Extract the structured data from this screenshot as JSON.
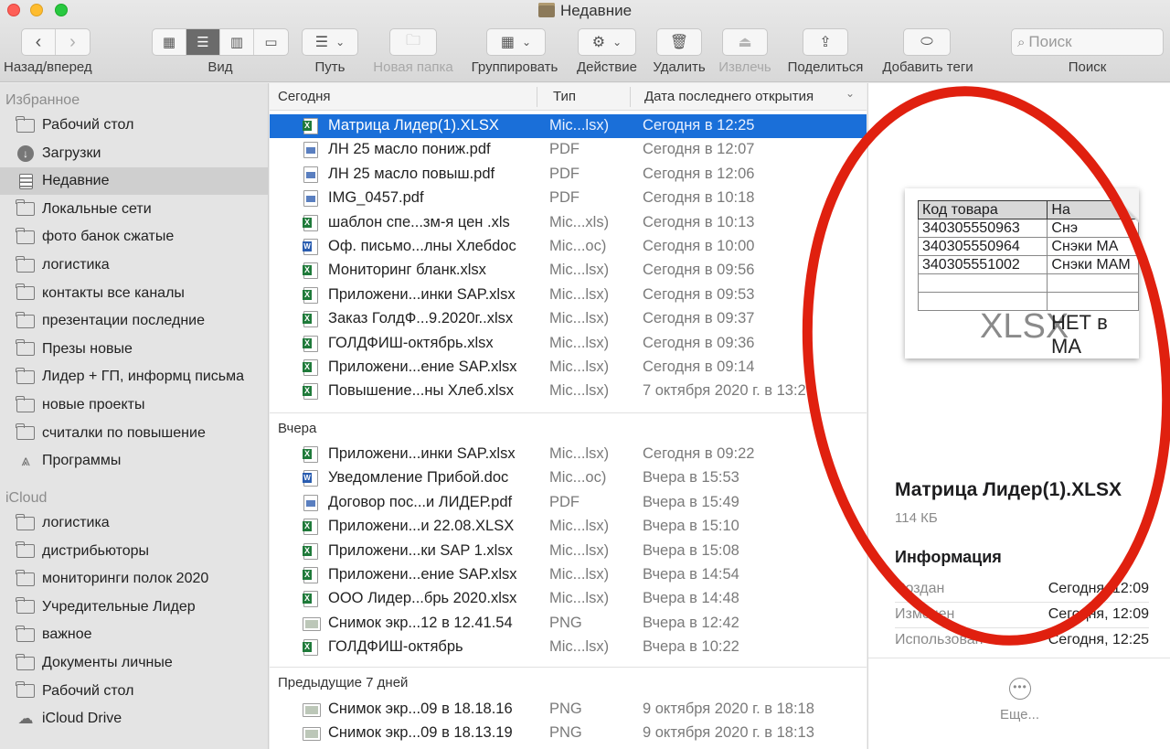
{
  "window": {
    "title": "Недавние"
  },
  "toolbar": {
    "nav_label": "Назад/вперед",
    "view_label": "Вид",
    "path_label": "Путь",
    "new_folder_label": "Новая папка",
    "group_label": "Группировать",
    "action_label": "Действие",
    "delete_label": "Удалить",
    "eject_label": "Извлечь",
    "share_label": "Поделиться",
    "tags_label": "Добавить теги",
    "search_label": "Поиск",
    "search_placeholder": "Поиск"
  },
  "sidebar": {
    "favorites_header": "Избранное",
    "favorites": [
      {
        "label": "Рабочий стол",
        "icon": "folder-icon"
      },
      {
        "label": "Загрузки",
        "icon": "downloads-icon"
      },
      {
        "label": "Недавние",
        "icon": "recents-icon",
        "active": true
      },
      {
        "label": "Локальные сети",
        "icon": "folder-icon"
      },
      {
        "label": "фото банок сжатые",
        "icon": "folder-icon"
      },
      {
        "label": "логистика",
        "icon": "folder-icon"
      },
      {
        "label": "контакты все каналы",
        "icon": "folder-icon"
      },
      {
        "label": "презентации последние",
        "icon": "folder-icon"
      },
      {
        "label": "Презы новые",
        "icon": "folder-icon"
      },
      {
        "label": "Лидер + ГП, информц письма",
        "icon": "folder-icon"
      },
      {
        "label": "новые проекты",
        "icon": "folder-icon"
      },
      {
        "label": "считалки по повышение",
        "icon": "folder-icon"
      },
      {
        "label": "Программы",
        "icon": "applications-icon"
      }
    ],
    "icloud_header": "iCloud",
    "icloud": [
      {
        "label": "логистика",
        "icon": "folder-icon"
      },
      {
        "label": "дистрибьюторы",
        "icon": "folder-icon"
      },
      {
        "label": "мониторинги полок 2020",
        "icon": "folder-icon"
      },
      {
        "label": "Учредительные Лидер",
        "icon": "folder-icon"
      },
      {
        "label": "важное",
        "icon": "folder-icon"
      },
      {
        "label": "Документы личные",
        "icon": "folder-icon"
      },
      {
        "label": "Рабочий стол",
        "icon": "folder-icon"
      },
      {
        "label": "iCloud Drive",
        "icon": "cloud-icon"
      }
    ]
  },
  "columns": {
    "name": "Сегодня",
    "type": "Тип",
    "date": "Дата последнего открытия"
  },
  "groups": {
    "today": {
      "label": "Сегодня",
      "rows": [
        {
          "name": "Матрица Лидер(1).XLSX",
          "type": "Mic...lsx)",
          "date": "Сегодня в 12:25",
          "icon": "xls",
          "selected": true
        },
        {
          "name": "ЛН 25 масло пониж.pdf",
          "type": "PDF",
          "date": "Сегодня в 12:07",
          "icon": "pdf"
        },
        {
          "name": "ЛН 25 масло повыш.pdf",
          "type": "PDF",
          "date": "Сегодня в 12:06",
          "icon": "pdf"
        },
        {
          "name": "IMG_0457.pdf",
          "type": "PDF",
          "date": "Сегодня в 10:18",
          "icon": "pdf"
        },
        {
          "name": "шаблон спе...зм-я цен .xls",
          "type": "Mic...xls)",
          "date": "Сегодня в 10:13",
          "icon": "xls"
        },
        {
          "name": "Оф. письмо...лны Хлебdoc",
          "type": "Mic...oc)",
          "date": "Сегодня в 10:00",
          "icon": "doc"
        },
        {
          "name": "Мониторинг бланк.xlsx",
          "type": "Mic...lsx)",
          "date": "Сегодня в 09:56",
          "icon": "xls"
        },
        {
          "name": "Приложени...инки SAP.xlsx",
          "type": "Mic...lsx)",
          "date": "Сегодня в 09:53",
          "icon": "xls"
        },
        {
          "name": "Заказ ГолдФ...9.2020г..xlsx",
          "type": "Mic...lsx)",
          "date": "Сегодня в 09:37",
          "icon": "xls"
        },
        {
          "name": "ГОЛДФИШ-октябрь.xlsx",
          "type": "Mic...lsx)",
          "date": "Сегодня в 09:36",
          "icon": "xls"
        },
        {
          "name": "Приложени...ение SAP.xlsx",
          "type": "Mic...lsx)",
          "date": "Сегодня в 09:14",
          "icon": "xls"
        },
        {
          "name": "Повышение...ны Хлеб.xlsx",
          "type": "Mic...lsx)",
          "date": "7 октября 2020 г. в 13:2",
          "icon": "xls"
        }
      ]
    },
    "yesterday": {
      "label": "Вчера",
      "rows": [
        {
          "name": "Приложени...инки SAP.xlsx",
          "type": "Mic...lsx)",
          "date": "Сегодня в 09:22",
          "icon": "xls"
        },
        {
          "name": "Уведомление Прибой.doc",
          "type": "Mic...oc)",
          "date": "Вчера в 15:53",
          "icon": "doc"
        },
        {
          "name": "Договор пос...и ЛИДЕР.pdf",
          "type": "PDF",
          "date": "Вчера в 15:49",
          "icon": "pdf"
        },
        {
          "name": "Приложени...и 22.08.XLSX",
          "type": "Mic...lsx)",
          "date": "Вчера в 15:10",
          "icon": "xls"
        },
        {
          "name": "Приложени...ки SAP 1.xlsx",
          "type": "Mic...lsx)",
          "date": "Вчера в 15:08",
          "icon": "xls"
        },
        {
          "name": "Приложени...ение SAP.xlsx",
          "type": "Mic...lsx)",
          "date": "Вчера в 14:54",
          "icon": "xls"
        },
        {
          "name": "ООО Лидер...брь 2020.xlsx",
          "type": "Mic...lsx)",
          "date": "Вчера в 14:48",
          "icon": "xls"
        },
        {
          "name": "Снимок экр...12 в 12.41.54",
          "type": "PNG",
          "date": "Вчера в 12:42",
          "icon": "png"
        },
        {
          "name": "ГОЛДФИШ-октябрь",
          "type": "Mic...lsx)",
          "date": "Вчера в 10:22",
          "icon": "xls"
        }
      ]
    },
    "week": {
      "label": "Предыдущие 7 дней",
      "rows": [
        {
          "name": "Снимок экр...09 в 18.18.16",
          "type": "PNG",
          "date": "9 октября 2020 г. в 18:18",
          "icon": "png"
        },
        {
          "name": "Снимок экр...09 в 18.13.19",
          "type": "PNG",
          "date": "9 октября 2020 г. в 18:13",
          "icon": "png"
        }
      ]
    }
  },
  "preview": {
    "thumb_header": [
      "Код товара",
      "На"
    ],
    "thumb_rows": [
      [
        "340305550963",
        "Снэ"
      ],
      [
        "340305550964",
        "Снэки МА"
      ],
      [
        "340305551002",
        "Снэки МАМ"
      ]
    ],
    "thumb_watermark": "XLSX",
    "thumb_note": "НЕТ в МА",
    "file_name": "Матрица Лидер(1).XLSX",
    "file_size": "114 КБ",
    "info_header": "Информация",
    "info": [
      {
        "key": "Создан",
        "value": "Сегодня, 12:09"
      },
      {
        "key": "Изменен",
        "value": "Сегодня, 12:09"
      },
      {
        "key": "Использован",
        "value": "Сегодня, 12:25"
      }
    ],
    "more_label": "Еще..."
  },
  "colors": {
    "selection": "#1a6fd9",
    "annotation": "#e0200f"
  }
}
